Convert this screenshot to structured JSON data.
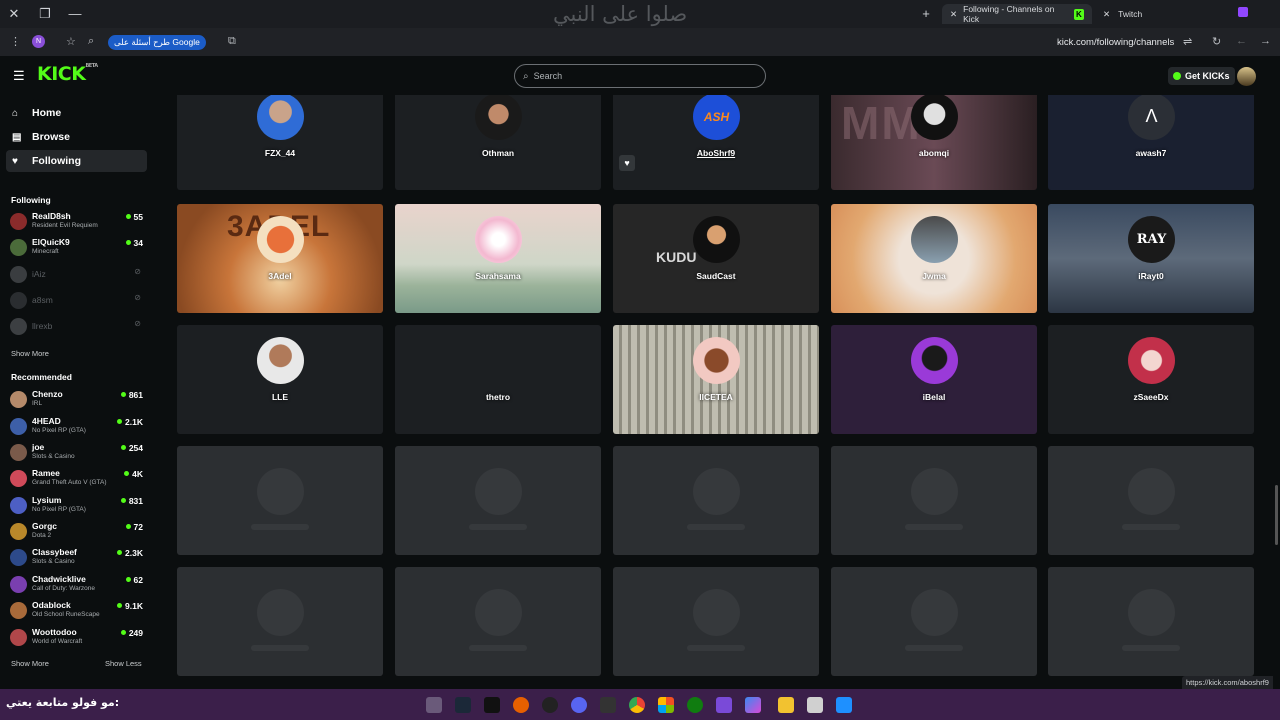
{
  "browser": {
    "watermark_text": "صلوا على النبي",
    "tabs": [
      {
        "label": "Following - Channels on Kick"
      },
      {
        "label": "Twitch"
      }
    ],
    "profile_initial": "N",
    "omnibox_chip": "طرح أسئلة على Google",
    "url": "kick.com/following/channels",
    "status_url": "https://kick.com/aboshrf9"
  },
  "kick": {
    "logo": "KICK",
    "logo_badge": "BETA",
    "search_placeholder": "Search",
    "get_kicks": "Get KICKs",
    "accent": "#53fc18",
    "nav": [
      {
        "label": "Home"
      },
      {
        "label": "Browse"
      },
      {
        "label": "Following"
      }
    ],
    "following_header": "Following",
    "following": [
      {
        "name": "RealD8sh",
        "game": "Resident Evil Requiem",
        "viewers": "55"
      },
      {
        "name": "ElQuicK9",
        "game": "Minecraft",
        "viewers": "34"
      },
      {
        "name": "iAiz"
      },
      {
        "name": "a8sm"
      },
      {
        "name": "llrexb"
      }
    ],
    "show_more_1": "Show More",
    "recommended_header": "Recommended",
    "recommended": [
      {
        "name": "Chenzo",
        "game": "IRL",
        "viewers": "861"
      },
      {
        "name": "4HEAD",
        "game": "No Pixel RP (GTA)",
        "viewers": "2.1K"
      },
      {
        "name": "joe",
        "game": "Slots & Casino",
        "viewers": "254"
      },
      {
        "name": "Ramee",
        "game": "Grand Theft Auto V (GTA)",
        "viewers": "4K"
      },
      {
        "name": "Lysium",
        "game": "No Pixel RP (GTA)",
        "viewers": "831"
      },
      {
        "name": "Gorgc",
        "game": "Dota 2",
        "viewers": "72"
      },
      {
        "name": "Classybeef",
        "game": "Slots & Casino",
        "viewers": "2.3K"
      },
      {
        "name": "Chadwicklive",
        "game": "Call of Duty: Warzone",
        "viewers": "62"
      },
      {
        "name": "Odablock",
        "game": "Old School RuneScape",
        "viewers": "9.1K"
      },
      {
        "name": "Woottodoo",
        "game": "World of Warcraft",
        "viewers": "249"
      }
    ],
    "show_more_2": "Show More",
    "show_less": "Show Less",
    "channels": [
      {
        "name": "FZX_44"
      },
      {
        "name": "Othman"
      },
      {
        "name": "AboShrf9"
      },
      {
        "name": "abomqi"
      },
      {
        "name": "awash7"
      },
      {
        "name": "3Adel"
      },
      {
        "name": "Sarahsama"
      },
      {
        "name": "SaudCast"
      },
      {
        "name": "Jwma"
      },
      {
        "name": "iRayt0"
      },
      {
        "name": "LLE"
      },
      {
        "name": "thetro"
      },
      {
        "name": "IICETEA"
      },
      {
        "name": "iBelal"
      },
      {
        "name": "zSaeeDx"
      }
    ],
    "card_logo_texts": {
      "abomqi_bg": "MMD",
      "aboshrf9_avatar": "ASH",
      "saudcast_bg": "KUDU",
      "irayt0_avatar": "RAY",
      "adel_bg": "3ADEL"
    }
  },
  "taskbar": {
    "left_text": "مو فولو متابعة يعتي:"
  }
}
